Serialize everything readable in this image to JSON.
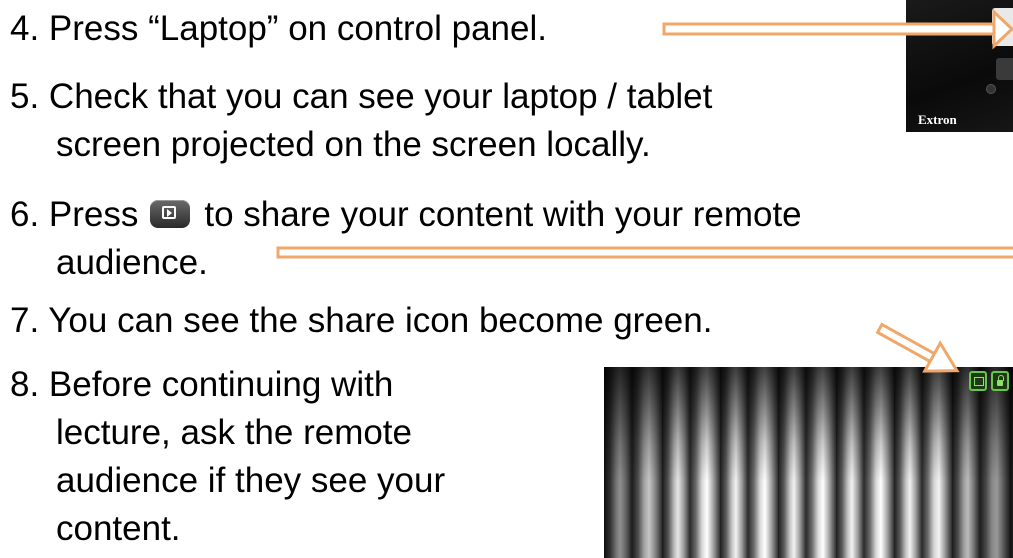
{
  "steps": [
    {
      "id": "4",
      "text": "4. Press “Laptop” on control panel."
    },
    {
      "id": "5",
      "text": "5. Check that you can see your laptop / tablet",
      "cont": "screen projected on the screen locally."
    },
    {
      "id": "6",
      "before": "6. Press",
      "after": "to share your content with your remote",
      "cont": "audience."
    },
    {
      "id": "7",
      "text": "7. You can see the share icon become green."
    },
    {
      "id": "8",
      "text": "8. Before continuing with",
      "cont": [
        "lecture, ask the remote",
        "audience if they see your",
        "content."
      ]
    }
  ],
  "panel": {
    "brand": "Extron"
  },
  "icons": {
    "share": "screen-share-icon",
    "status_share": "share-active-icon",
    "status_lock": "lock-icon"
  },
  "colors": {
    "arrow": "#f0a76a",
    "status_green": "#66c74a"
  }
}
